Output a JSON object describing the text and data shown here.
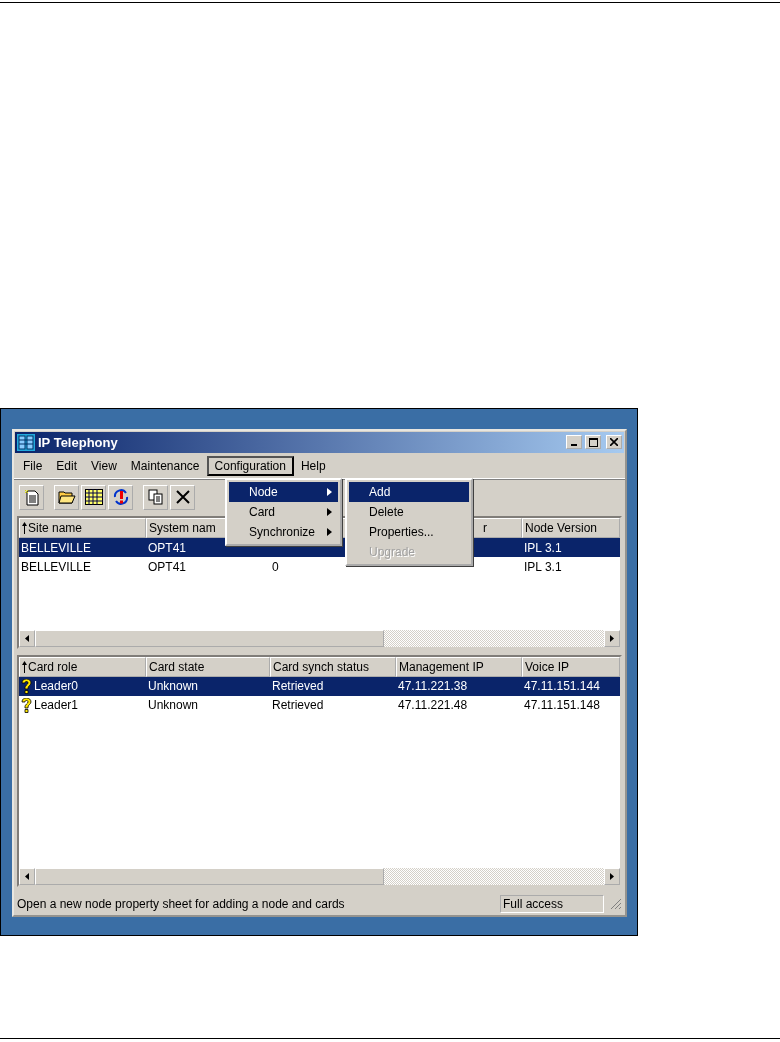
{
  "window": {
    "title": "IP Telephony"
  },
  "menu_bar": [
    {
      "label": "File",
      "selected": false
    },
    {
      "label": "Edit",
      "selected": false
    },
    {
      "label": "View",
      "selected": false
    },
    {
      "label": "Maintenance",
      "selected": false
    },
    {
      "label": "Configuration",
      "selected": true
    },
    {
      "label": "Help",
      "selected": false
    }
  ],
  "dropdown": [
    {
      "label": "Node",
      "selected": true,
      "submenu": true
    },
    {
      "label": "Card",
      "selected": false,
      "submenu": true
    },
    {
      "label": "Synchronize",
      "selected": false,
      "submenu": true
    }
  ],
  "submenu": [
    {
      "label": "Add",
      "selected": true,
      "disabled": false
    },
    {
      "label": "Delete",
      "selected": false,
      "disabled": false
    },
    {
      "label": "Properties...",
      "selected": false,
      "disabled": false
    },
    {
      "label": "Upgrade",
      "selected": false,
      "disabled": true
    }
  ],
  "node_list": {
    "columns": [
      {
        "label": "Site name",
        "sorted": true
      },
      {
        "label": "System nam",
        "sorted": false
      },
      null,
      {
        "label": "r",
        "sorted": false
      },
      {
        "label": "Node Version",
        "sorted": false
      }
    ],
    "rows": [
      {
        "selected": true,
        "cells": [
          "BELLEVILLE",
          "OPT41",
          null,
          null,
          "IPL 3.1"
        ]
      },
      {
        "selected": false,
        "cells": [
          "BELLEVILLE",
          "OPT41",
          "0",
          null,
          "IPL 3.1"
        ]
      }
    ]
  },
  "card_list": {
    "columns": [
      {
        "label": "Card role",
        "sorted": true
      },
      {
        "label": "Card state",
        "sorted": false
      },
      {
        "label": "Card synch status",
        "sorted": false
      },
      {
        "label": "Management IP",
        "sorted": false
      },
      {
        "label": "Voice IP",
        "sorted": false
      }
    ],
    "rows": [
      {
        "selected": true,
        "cells": [
          "Leader0",
          "Unknown",
          "Retrieved",
          "47.11.221.38",
          "47.11.151.144"
        ]
      },
      {
        "selected": false,
        "cells": [
          "Leader1",
          "Unknown",
          "Retrieved",
          "47.11.221.48",
          "47.11.151.148"
        ]
      }
    ]
  },
  "status_bar": {
    "message": "Open a new node property sheet for adding a node and cards",
    "access": "Full access"
  }
}
